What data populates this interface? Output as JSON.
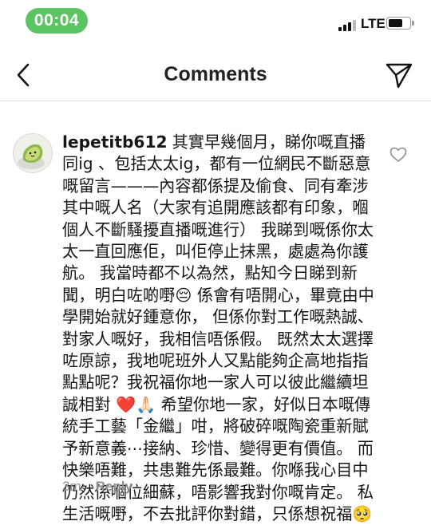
{
  "status": {
    "time": "00:04",
    "network": "LTE"
  },
  "nav": {
    "title": "Comments"
  },
  "comment": {
    "username": "lepetitb612",
    "text": "其實早幾個月，睇你嘅直播同ig 、包括太太ig，都有一位網民不斷惡意嘅留言———內容都係提及偷食、同有牽涉其中嘅人名（大家有追開應該都有印象，嗰個人不斷騷擾直播嘅進行） 我睇到嘅係你太太一直回應佢，叫佢停止抹黑，處處為你護航。 我當時都不以為然，點知今日睇到新聞，明白咗啲嘢😔 係會有唔開心，畢竟由中學開始就好鍾意你， 但係你對工作嘅熱誠、對家人嘅好，我相信唔係假。 既然太太選擇咗原諒，我地呢班外人又點能夠企高地指指點點呢？我祝福你地一家人可以彼此繼續坦誠相對 ❤️🙏🏻 希望你地一家，好似日本嘅傳統手工藝「金繼」咁，將破碎嘅陶瓷重新賦予新意義⋯接納、珍惜、變得更有價值。 而快樂唔難，共患難先係最難。你喺我心目中仍然係嗰位細蘇，唔影響我對你嘅肯定。 私生活嘅嘢，不去批評你對錯，只係想祝福🥺",
    "age": "3m",
    "reply_label": "Reply"
  }
}
